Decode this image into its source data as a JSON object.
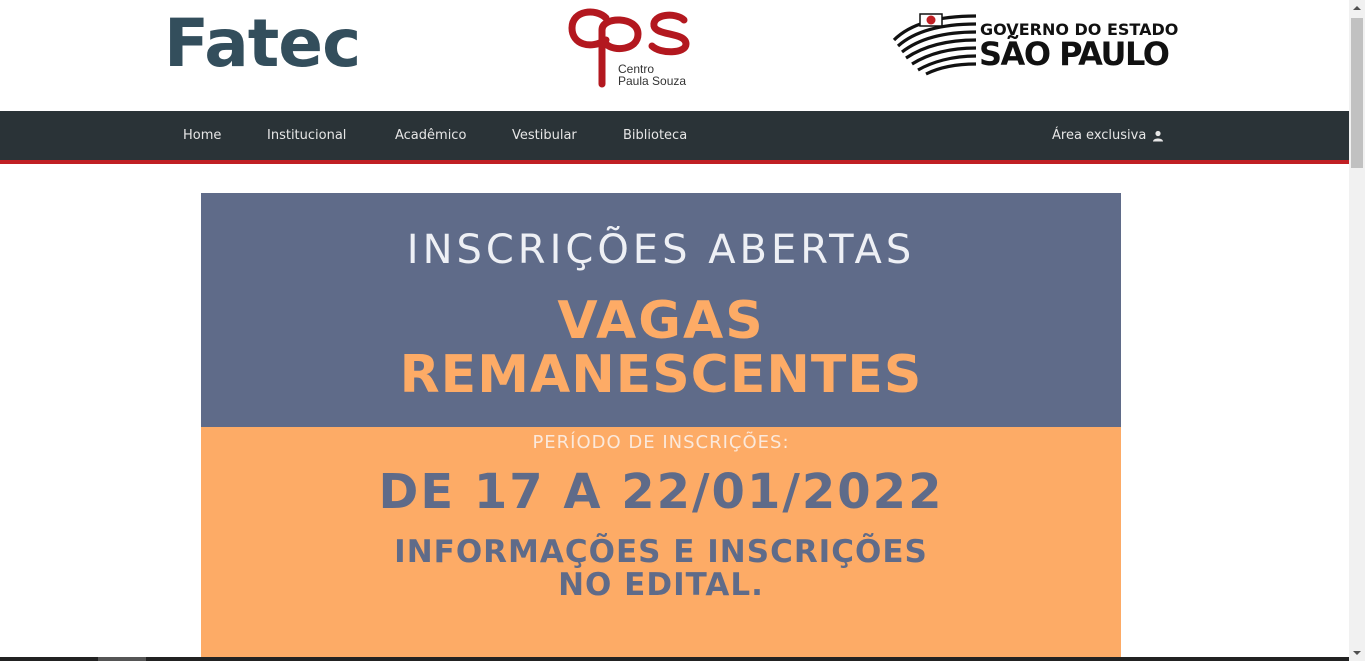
{
  "header": {
    "fatec_logo": "Fatec",
    "cps_logo": {
      "mark": "cps",
      "line1": "Centro",
      "line2": "Paula Souza",
      "color": "#b3181f"
    },
    "gov_logo": {
      "line1": "GOVERNO DO ESTADO",
      "line2": "SÃO PAULO"
    }
  },
  "nav": {
    "items": [
      {
        "label": "Home"
      },
      {
        "label": "Institucional"
      },
      {
        "label": "Acadêmico"
      },
      {
        "label": "Vestibular"
      },
      {
        "label": "Biblioteca"
      }
    ],
    "area_exclusiva": "Área exclusiva",
    "bar_color": "#2a3337",
    "accent_color": "#c01f24"
  },
  "banner": {
    "line1": "INSCRIÇÕES ABERTAS",
    "line2": "VAGAS",
    "line3": "REMANESCENTES",
    "line4": "PERÍODO DE INSCRIÇÕES:",
    "line5": "DE 17 A 22/01/2022",
    "line6": "INFORMAÇÕES E INSCRIÇÕES",
    "line7": "NO EDITAL.",
    "top_color": "#5f6b89",
    "bottom_color": "#fdab66"
  }
}
